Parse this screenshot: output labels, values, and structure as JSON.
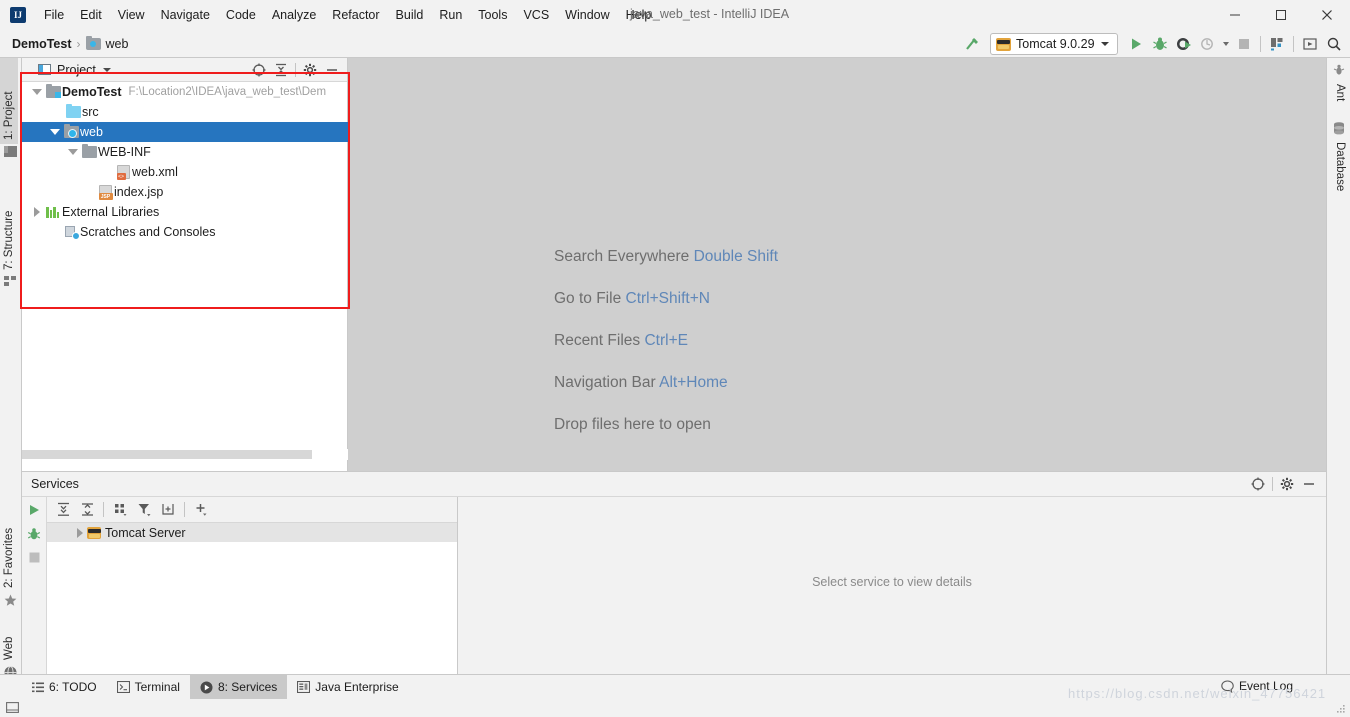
{
  "window": {
    "title": "java_web_test - IntelliJ IDEA",
    "logo_text": "IJ",
    "minimize": "─",
    "maximize": "☐",
    "close": "✕"
  },
  "menu": {
    "items": [
      {
        "label": "File"
      },
      {
        "label": "Edit"
      },
      {
        "label": "View"
      },
      {
        "label": "Navigate"
      },
      {
        "label": "Code"
      },
      {
        "label": "Analyze"
      },
      {
        "label": "Refactor"
      },
      {
        "label": "Build"
      },
      {
        "label": "Run"
      },
      {
        "label": "Tools"
      },
      {
        "label": "VCS"
      },
      {
        "label": "Window"
      },
      {
        "label": "Help"
      }
    ]
  },
  "navbar": {
    "breadcrumb_project": "DemoTest",
    "breadcrumb_sep": "›",
    "breadcrumb_item": "web",
    "run_config": "Tomcat 9.0.29"
  },
  "stripes": {
    "left_top": [
      {
        "label": "1: Project",
        "active": true
      },
      {
        "label": "7: Structure",
        "active": false
      }
    ],
    "left_bottom": [
      {
        "label": "2: Favorites"
      },
      {
        "label": "Web"
      }
    ],
    "right": [
      {
        "label": "Ant"
      },
      {
        "label": "Database"
      }
    ]
  },
  "project_panel": {
    "title": "Project",
    "tree": [
      {
        "name": "DemoTest",
        "path": "F:\\Location2\\IDEA\\java_web_test\\Dem",
        "icon": "module-icon",
        "indent": 0,
        "twisty": "down",
        "bold": true,
        "selected": false
      },
      {
        "name": "src",
        "path": "",
        "icon": "source-folder-icon",
        "indent": 1,
        "twisty": "none",
        "bold": false,
        "selected": false
      },
      {
        "name": "web",
        "path": "",
        "icon": "web-folder-icon",
        "indent": 1,
        "twisty": "down",
        "bold": false,
        "selected": true
      },
      {
        "name": "WEB-INF",
        "path": "",
        "icon": "folder-icon",
        "indent": 2,
        "twisty": "down",
        "bold": false,
        "selected": false
      },
      {
        "name": "web.xml",
        "path": "",
        "icon": "xml-file-icon",
        "indent": 3,
        "twisty": "none",
        "bold": false,
        "selected": false
      },
      {
        "name": "index.jsp",
        "path": "",
        "icon": "jsp-file-icon",
        "indent": 2,
        "twisty": "none",
        "bold": false,
        "selected": false
      },
      {
        "name": "External Libraries",
        "path": "",
        "icon": "library-icon",
        "indent": 0,
        "twisty": "right",
        "bold": false,
        "selected": false
      },
      {
        "name": "Scratches and Consoles",
        "path": "",
        "icon": "scratch-icon",
        "indent": 0,
        "twisty": "none",
        "bold": false,
        "selected": false
      }
    ]
  },
  "editor": {
    "hints": [
      {
        "action": "Search Everywhere",
        "shortcut": "Double Shift"
      },
      {
        "action": "Go to File",
        "shortcut": "Ctrl+Shift+N"
      },
      {
        "action": "Recent Files",
        "shortcut": "Ctrl+E"
      },
      {
        "action": "Navigation Bar",
        "shortcut": "Alt+Home"
      },
      {
        "action": "Drop files here to open",
        "shortcut": ""
      }
    ]
  },
  "services": {
    "title": "Services",
    "root_node": "Tomcat Server",
    "placeholder": "Select service to view details"
  },
  "statusbar": {
    "tabs": [
      {
        "label": "6: TODO",
        "icon": "todo-icon",
        "active": false
      },
      {
        "label": "Terminal",
        "icon": "terminal-icon",
        "active": false
      },
      {
        "label": "8: Services",
        "icon": "services-icon",
        "active": true
      },
      {
        "label": "Java Enterprise",
        "icon": "java-enterprise-icon",
        "active": false
      }
    ],
    "event_log": "Event Log",
    "watermark": "https://blog.csdn.net/weixin_47756421"
  },
  "colors": {
    "accent_selection": "#2675bf",
    "annotation_red": "#ef1c1c",
    "run_green": "#59a869",
    "hint_link": "#5f87b8",
    "editor_bg": "#cfcfcf"
  }
}
